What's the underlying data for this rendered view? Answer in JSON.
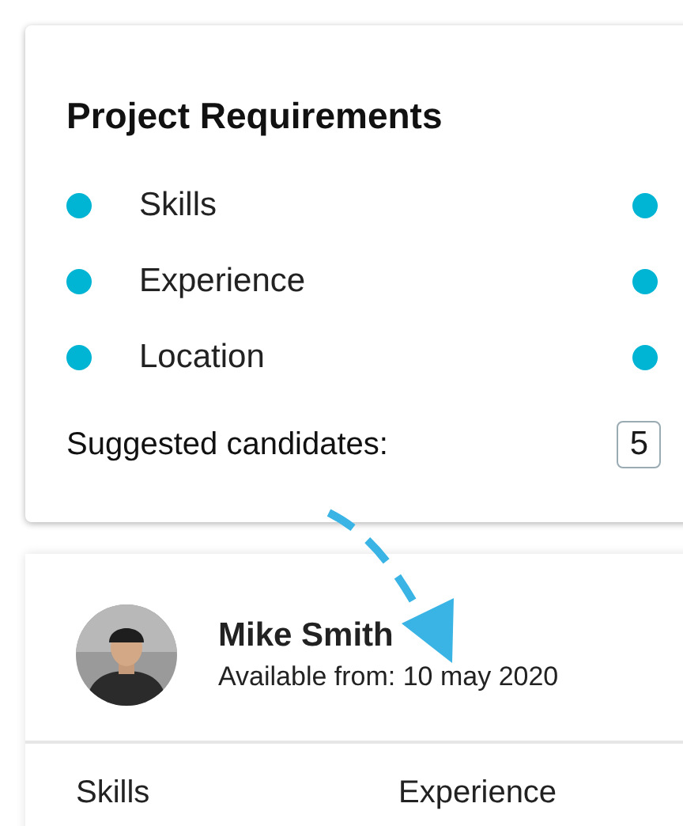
{
  "requirements_card": {
    "title": "Project Requirements",
    "requirements": [
      {
        "label": "Skills"
      },
      {
        "label": "Experience"
      },
      {
        "label": "Location"
      }
    ],
    "suggested_label": "Suggested candidates:",
    "suggested_count": "5"
  },
  "candidate_card": {
    "name": "Mike Smith",
    "availability": "Available from: 10 may 2020",
    "avatar": {
      "kind": "picture"
    },
    "columns": [
      "Skills",
      "Experience"
    ]
  }
}
